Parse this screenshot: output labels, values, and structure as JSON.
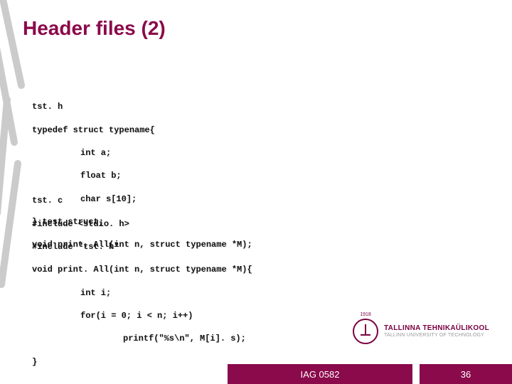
{
  "title": "Header files (2)",
  "code_h": {
    "filename": "tst. h",
    "lines": [
      "typedef struct typename{",
      "int a;",
      "float b;",
      "char s[10];",
      "} test_struct;",
      "void print. All(int n, struct typename *M);"
    ]
  },
  "code_c": {
    "filename": "tst. c",
    "lines": [
      "#include <stdio. h>",
      "#include \"tst. h\"",
      "void print. All(int n, struct typename *M){",
      "int i;",
      "for(i = 0; i < n; i++)",
      "printf(\"%s\\n\", M[i]. s);",
      "}"
    ]
  },
  "logo": {
    "year": "1918",
    "line1": "TALLINNA TEHNIKAÜLIKOOL",
    "line2": "TALLINN UNIVERSITY OF TECHNOLOGY"
  },
  "footer": {
    "course": "IAG 0582",
    "page": "36"
  }
}
